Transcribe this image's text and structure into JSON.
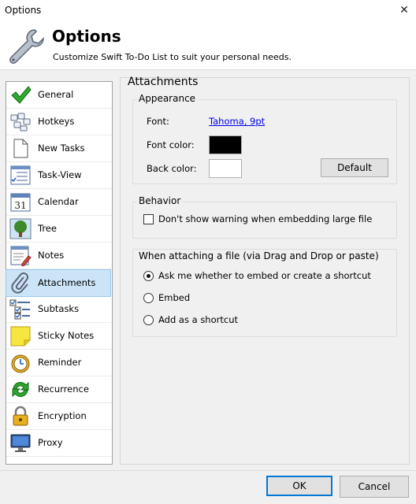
{
  "window": {
    "title": "Options",
    "close_glyph": "✕"
  },
  "header": {
    "title": "Options",
    "subtitle": "Customize Swift To-Do List to suit your personal needs.",
    "icon": "wrench-icon"
  },
  "sidebar": {
    "items": [
      {
        "label": "General",
        "icon": "checkmark-icon",
        "selected": false
      },
      {
        "label": "Hotkeys",
        "icon": "keyboard-icon",
        "selected": false
      },
      {
        "label": "New Tasks",
        "icon": "document-icon",
        "selected": false
      },
      {
        "label": "Task-View",
        "icon": "task-view-icon",
        "selected": false
      },
      {
        "label": "Calendar",
        "icon": "calendar-icon",
        "calendar_day": "31",
        "selected": false
      },
      {
        "label": "Tree",
        "icon": "tree-icon",
        "selected": false
      },
      {
        "label": "Notes",
        "icon": "notes-icon",
        "selected": false
      },
      {
        "label": "Attachments",
        "icon": "paperclip-icon",
        "selected": true
      },
      {
        "label": "Subtasks",
        "icon": "subtasks-icon",
        "selected": false
      },
      {
        "label": "Sticky Notes",
        "icon": "sticky-note-icon",
        "selected": false
      },
      {
        "label": "Reminder",
        "icon": "alarm-clock-icon",
        "selected": false
      },
      {
        "label": "Recurrence",
        "icon": "recurrence-icon",
        "selected": false
      },
      {
        "label": "Encryption",
        "icon": "padlock-icon",
        "selected": false
      },
      {
        "label": "Proxy",
        "icon": "monitor-icon",
        "selected": false
      }
    ]
  },
  "main": {
    "section_title": "Attachments",
    "appearance": {
      "group_label": "Appearance",
      "font_label": "Font:",
      "font_value": "Tahoma, 9pt",
      "font_color_label": "Font color:",
      "font_color": "#000000",
      "back_color_label": "Back color:",
      "back_color": "#ffffff",
      "default_button": "Default"
    },
    "behavior": {
      "group_label": "Behavior",
      "warning_checkbox_label": "Don't show warning when embedding large file",
      "warning_checked": false
    },
    "attach_mode": {
      "group_label": "When attaching a file (via Drag and Drop or paste)",
      "options": [
        {
          "label": "Ask me whether to embed or create a shortcut",
          "selected": true
        },
        {
          "label": "Embed",
          "selected": false
        },
        {
          "label": "Add as a shortcut",
          "selected": false
        }
      ]
    }
  },
  "footer": {
    "ok_label": "OK",
    "cancel_label": "Cancel"
  },
  "colors": {
    "accent": "#0078d7",
    "selection_bg": "#cce4f7",
    "link": "#0000ee"
  }
}
